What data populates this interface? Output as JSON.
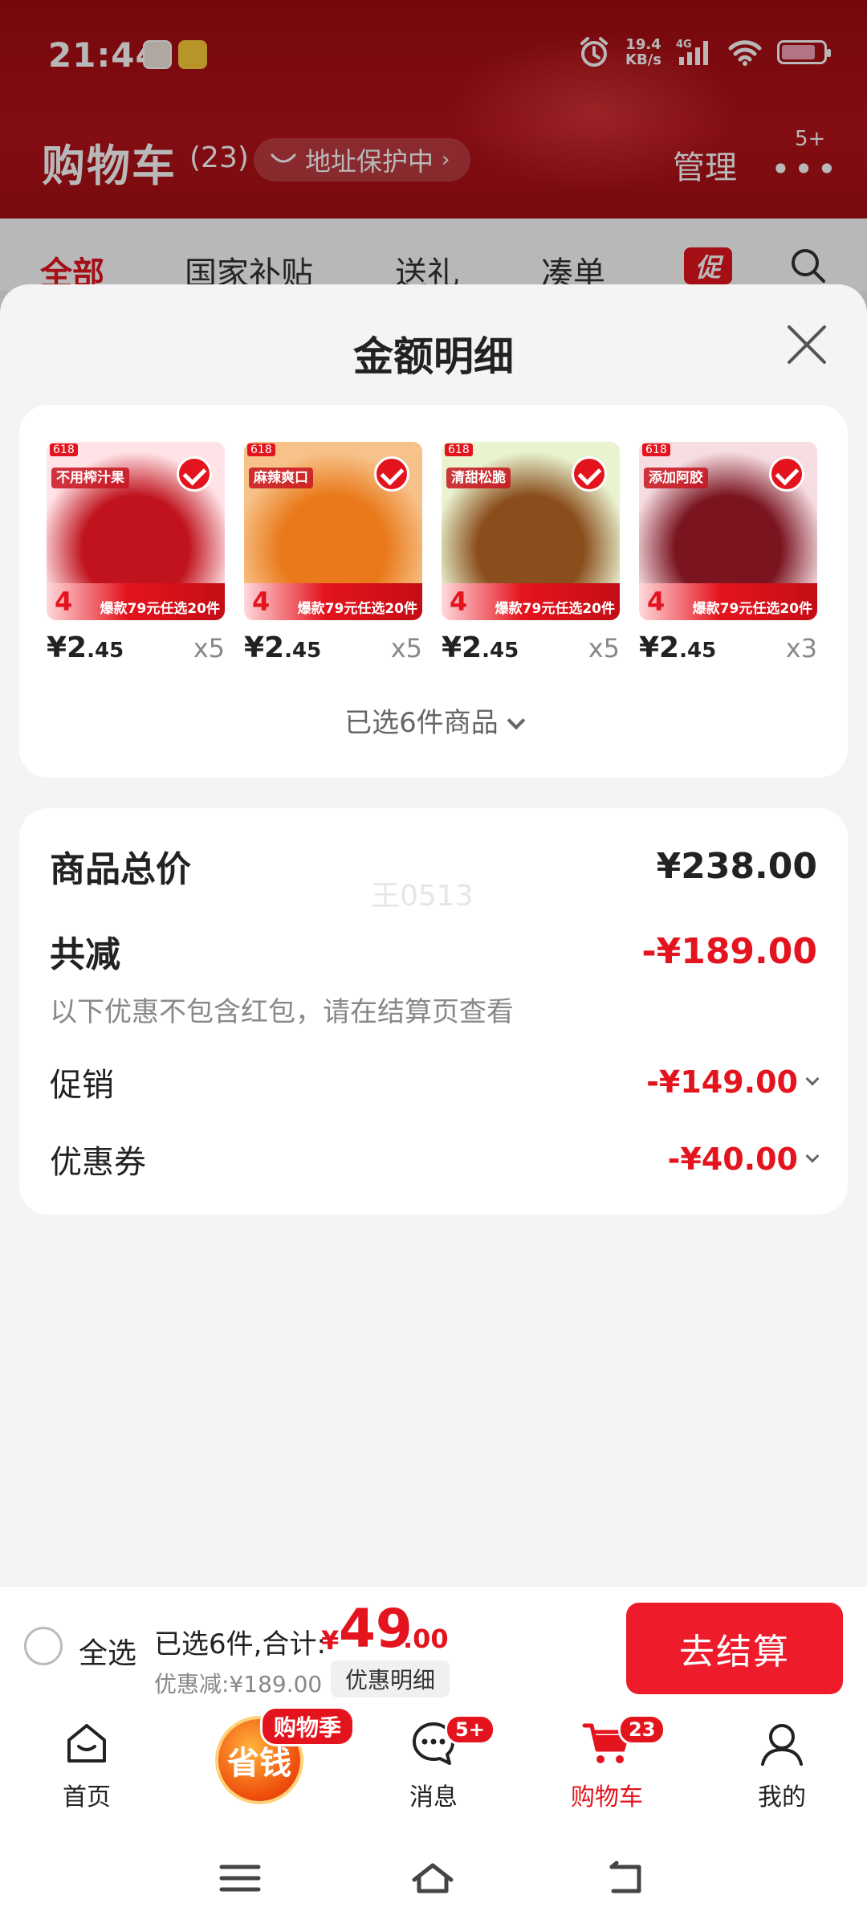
{
  "status_bar": {
    "time": "21:44",
    "net_speed": "19.4",
    "net_unit": "KB/s",
    "net_type": "4G"
  },
  "cart_header": {
    "title": "购物车",
    "count": "(23)",
    "address_protect": "地址保护中",
    "manage": "管理",
    "more_badge": "5+"
  },
  "cart_tabs": [
    {
      "label": "全部"
    },
    {
      "label": "国家补贴"
    },
    {
      "label": "送礼"
    },
    {
      "label": "凑单"
    }
  ],
  "promo_tag": "促",
  "sheet": {
    "title": "金额明细",
    "products": [
      {
        "slogan": "不用榨汁果",
        "price_int": "¥2",
        "price_dec": ".45",
        "qty": "x5",
        "strip_num": "4",
        "strip_text": "爆款79元任选20件",
        "colors": [
          "#ffe3e6",
          "#c0131d"
        ]
      },
      {
        "slogan": "麻辣爽口",
        "price_int": "¥2",
        "price_dec": ".45",
        "qty": "x5",
        "strip_num": "4",
        "strip_text": "爆款79元任选20件",
        "colors": [
          "#f7c289",
          "#e9791a"
        ]
      },
      {
        "slogan": "清甜松脆",
        "price_int": "¥2",
        "price_dec": ".45",
        "qty": "x5",
        "strip_num": "4",
        "strip_text": "爆款79元任选20件",
        "colors": [
          "#e9f3d0",
          "#8a4d1c"
        ]
      },
      {
        "slogan": "添加阿胶",
        "price_int": "¥2",
        "price_dec": ".45",
        "qty": "x3",
        "strip_num": "4",
        "strip_text": "爆款79元任选20件",
        "colors": [
          "#f6dde2",
          "#7a1520"
        ]
      }
    ],
    "selected_label": "已选6件商品",
    "summary": {
      "total_label": "商品总价",
      "total_value": "¥238.00",
      "watermark": "王0513",
      "reduce_label": "共减",
      "reduce_value": "-¥189.00",
      "note": "以下优惠不包含红包，请在结算页查看",
      "promo_label": "促销",
      "promo_value": "-¥149.00",
      "coupon_label": "优惠券",
      "coupon_value": "-¥40.00"
    }
  },
  "checkout": {
    "select_all": "全选",
    "selected_count": "已选6件,合计:",
    "currency": "¥",
    "total_int": "49",
    "total_dec": ".00",
    "discount": "优惠减:¥189.00",
    "detail_btn": "优惠明细",
    "pay_btn": "去结算"
  },
  "bottom_nav": {
    "home": "首页",
    "promo_badge": "购物季",
    "promo_center": "省钱",
    "messages": "消息",
    "messages_badge": "5+",
    "cart": "购物车",
    "cart_badge": "23",
    "mine": "我的"
  },
  "colors": {
    "accent": "#e4141e",
    "header_bg": "#a30c12"
  }
}
